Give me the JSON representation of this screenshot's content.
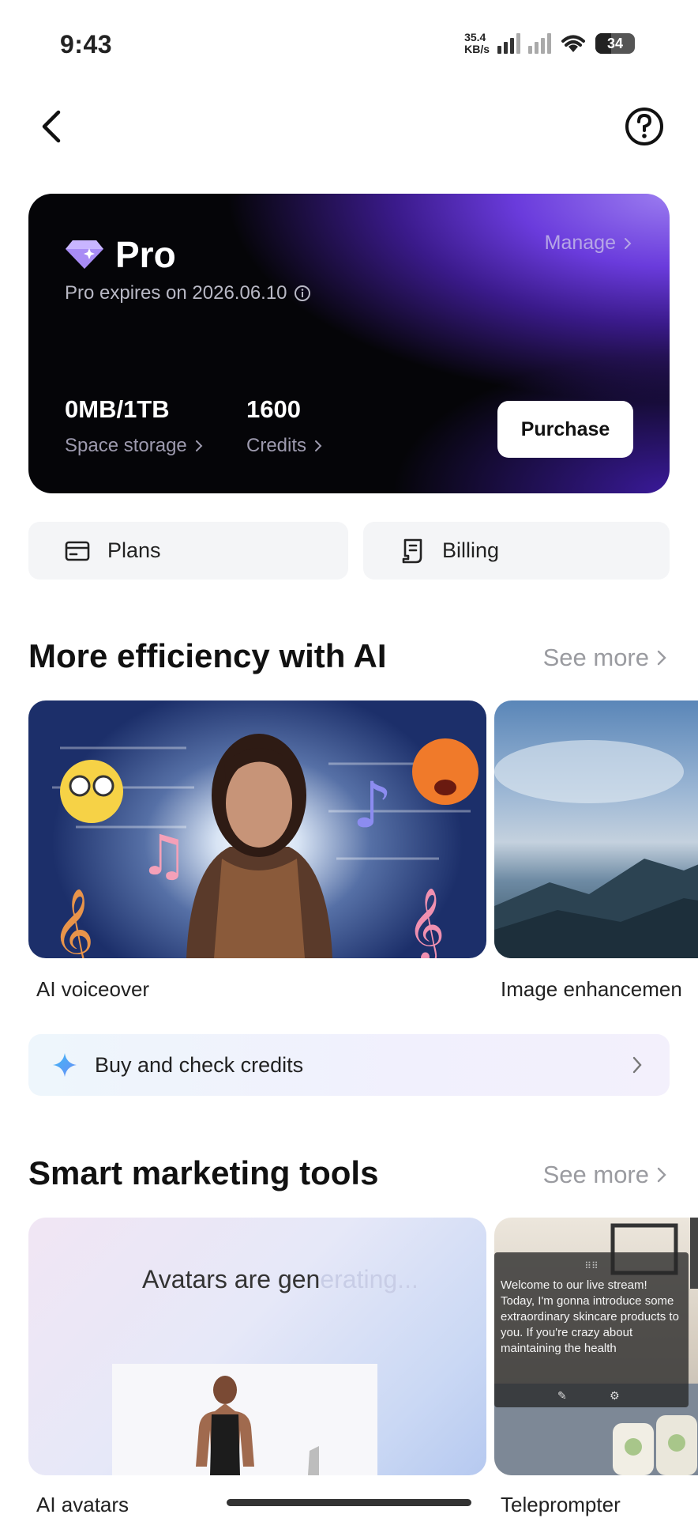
{
  "status_bar": {
    "time": "9:43",
    "net_speed_value": "35.4",
    "net_speed_unit": "KB/s",
    "battery": "34"
  },
  "subscription": {
    "plan_name": "Pro",
    "manage_label": "Manage",
    "expires_text": "Pro expires on 2026.06.10",
    "storage_value": "0MB/1TB",
    "storage_label": "Space storage",
    "credits_value": "1600",
    "credits_label": "Credits",
    "purchase_label": "Purchase"
  },
  "quick_actions": {
    "plans_label": "Plans",
    "billing_label": "Billing"
  },
  "ai_section": {
    "title": "More efficiency with AI",
    "see_more": "See more",
    "cards": [
      {
        "label": "AI voiceover"
      },
      {
        "label": "Image enhancemen"
      }
    ]
  },
  "credits_banner": {
    "label": "Buy and check credits"
  },
  "marketing_section": {
    "title": "Smart marketing tools",
    "see_more": "See more",
    "cards": [
      {
        "label": "AI avatars",
        "overlay_text": "Avatars are gen",
        "overlay_faded": "erating..."
      },
      {
        "label": "Teleprompter",
        "script_text": "Welcome to our live stream! Today, I'm gonna introduce some extraordinary skincare products to you. If you're crazy about maintaining the health"
      }
    ]
  },
  "colors": {
    "accent_purple": "#6a3bdc",
    "card_dark": "#050508",
    "muted_text": "#9a9ba0"
  }
}
